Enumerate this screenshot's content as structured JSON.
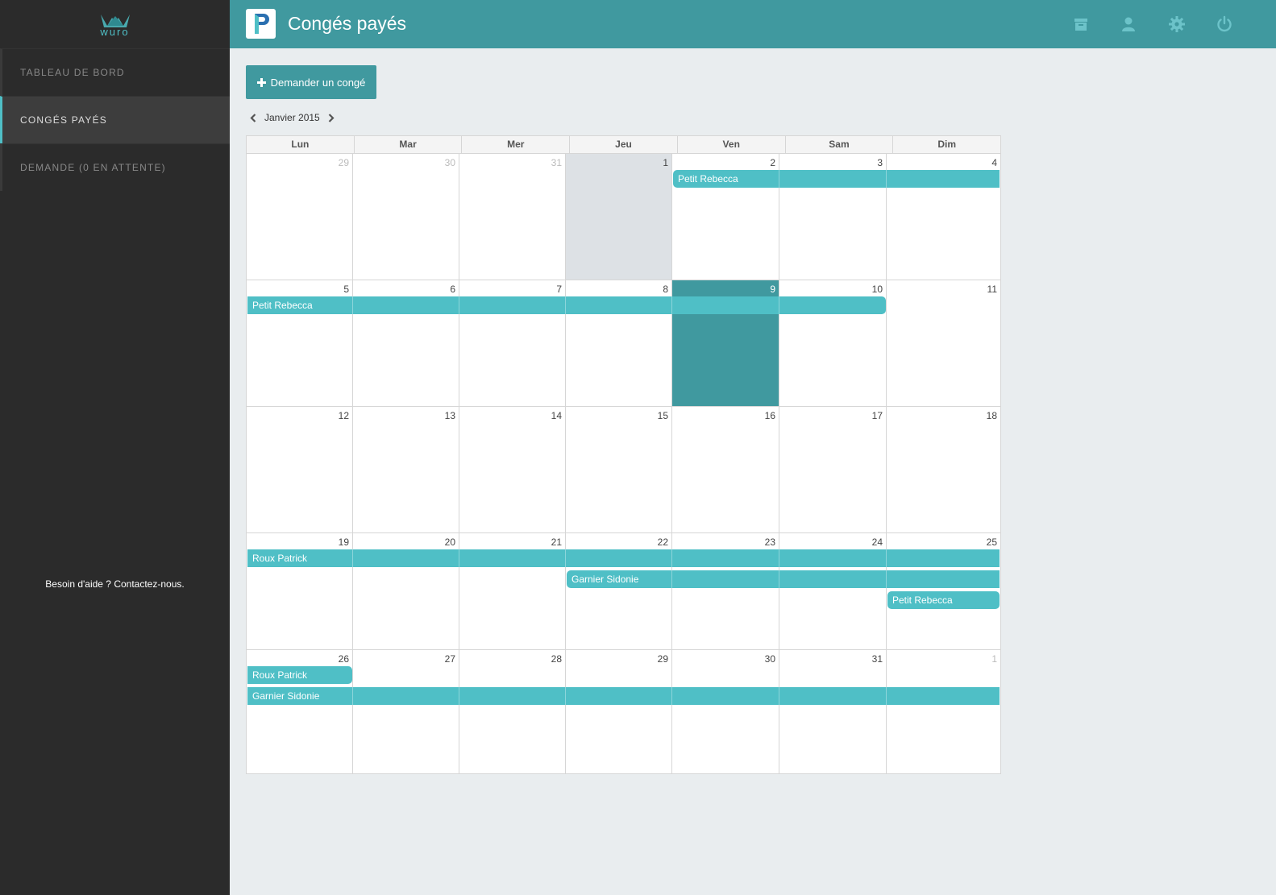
{
  "sidebar": {
    "logo_text": "wuro",
    "items": [
      {
        "label": "TABLEAU DE BORD",
        "active": false
      },
      {
        "label": "CONGÉS PAYÉS",
        "active": true
      },
      {
        "label": "DEMANDE (0 EN ATTENTE)",
        "active": false
      }
    ],
    "help": "Besoin d'aide ? Contactez-nous."
  },
  "header": {
    "title": "Congés payés",
    "icons": [
      "archive-icon",
      "user-icon",
      "gear-icon",
      "power-icon"
    ]
  },
  "toolbar": {
    "request_label": "Demander un congé"
  },
  "calendar": {
    "month_label": "Janvier 2015",
    "weekdays": [
      "Lun",
      "Mar",
      "Mer",
      "Jeu",
      "Ven",
      "Sam",
      "Dim"
    ],
    "weeks": [
      {
        "days": [
          "29",
          "30",
          "31",
          "1",
          "2",
          "3",
          "4"
        ],
        "other": [
          true,
          true,
          true,
          false,
          false,
          false,
          false
        ]
      },
      {
        "days": [
          "5",
          "6",
          "7",
          "8",
          "9",
          "10",
          "11"
        ],
        "other": [
          false,
          false,
          false,
          false,
          false,
          false,
          false
        ]
      },
      {
        "days": [
          "12",
          "13",
          "14",
          "15",
          "16",
          "17",
          "18"
        ],
        "other": [
          false,
          false,
          false,
          false,
          false,
          false,
          false
        ]
      },
      {
        "days": [
          "19",
          "20",
          "21",
          "22",
          "23",
          "24",
          "25"
        ],
        "other": [
          false,
          false,
          false,
          false,
          false,
          false,
          false
        ]
      },
      {
        "days": [
          "26",
          "27",
          "28",
          "29",
          "30",
          "31",
          "1"
        ],
        "other": [
          false,
          false,
          false,
          false,
          false,
          false,
          true
        ]
      }
    ],
    "highlighted_day": "1",
    "today": "9",
    "events": [
      {
        "name": "Petit Rebecca",
        "week": 0,
        "start": 4,
        "end": 6,
        "row": 0,
        "starts_here": true,
        "ends_here": false
      },
      {
        "name": "Petit Rebecca",
        "week": 1,
        "start": 0,
        "end": 5,
        "row": 0,
        "starts_here": false,
        "ends_here": true
      },
      {
        "name": "Roux Patrick",
        "week": 3,
        "start": 0,
        "end": 6,
        "row": 0,
        "starts_here": false,
        "ends_here": false
      },
      {
        "name": "Garnier Sidonie",
        "week": 3,
        "start": 3,
        "end": 6,
        "row": 1,
        "starts_here": true,
        "ends_here": false
      },
      {
        "name": "Petit Rebecca",
        "week": 3,
        "start": 6,
        "end": 6,
        "row": 2,
        "starts_here": true,
        "ends_here": true
      },
      {
        "name": "Roux Patrick",
        "week": 4,
        "start": 0,
        "end": 0,
        "row": 0,
        "starts_here": false,
        "ends_here": true
      },
      {
        "name": "Garnier Sidonie",
        "week": 4,
        "start": 0,
        "end": 6,
        "row": 1,
        "starts_here": false,
        "ends_here": false
      }
    ]
  },
  "colors": {
    "accent": "#40999f",
    "event": "#4fbfc6",
    "sidebar": "#2b2b2b",
    "background": "#e9edef"
  }
}
